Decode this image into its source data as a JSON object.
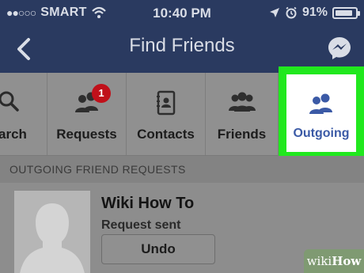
{
  "status_bar": {
    "carrier": "SMART",
    "time": "10:40 PM",
    "battery": "91%",
    "battery_level": 0.91
  },
  "nav": {
    "title": "Find Friends"
  },
  "tabs": [
    {
      "label": "arch",
      "icon": "search-icon"
    },
    {
      "label": "Requests",
      "icon": "friend-requests-icon",
      "badge": "1"
    },
    {
      "label": "Contacts",
      "icon": "contacts-book-icon"
    },
    {
      "label": "Friends",
      "icon": "friends-icon"
    },
    {
      "label": "Outgoing",
      "icon": "outgoing-requests-icon",
      "selected": true
    }
  ],
  "section": {
    "header": "OUTGOING FRIEND REQUESTS"
  },
  "requests": [
    {
      "name": "Wiki How To",
      "status": "Request sent",
      "action_label": "Undo"
    }
  ],
  "watermark": {
    "prefix": "wiki",
    "suffix": "How"
  },
  "colors": {
    "nav_bar": "#2a3a60",
    "highlight": "#21e81e",
    "selected_tab_text": "#3b5aa6",
    "badge": "#c0101a"
  }
}
